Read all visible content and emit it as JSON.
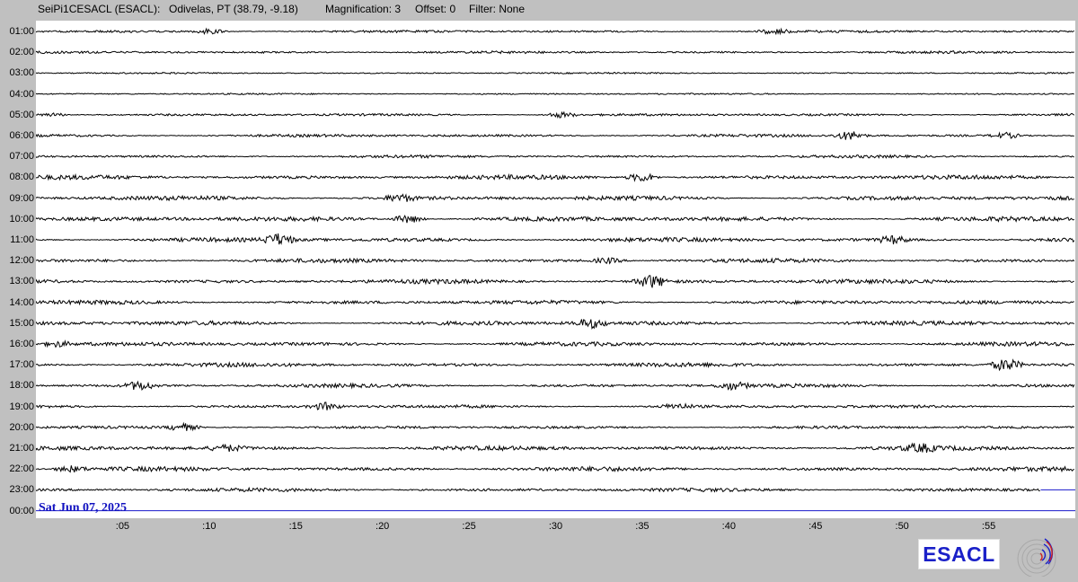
{
  "header": {
    "station": "SeiPi1CESACL (ESACL):",
    "location": "Odivelas, PT (38.79, -9.18)",
    "magnification": "Magnification: 3",
    "offset": "Offset: 0",
    "filter": "Filter: None"
  },
  "date": "Sat Jun 07, 2025",
  "logo": {
    "text": "ESACL",
    "color": "#1a20c8",
    "emblem": "seismograph-emblem"
  },
  "colors": {
    "trace": "#000000",
    "current_line": "#1a1acc",
    "background": "#c0c0c0",
    "plot": "#ffffff"
  },
  "chart_data": {
    "type": "line",
    "title": "",
    "rows": [
      "01:00",
      "02:00",
      "03:00",
      "04:00",
      "05:00",
      "06:00",
      "07:00",
      "08:00",
      "09:00",
      "10:00",
      "11:00",
      "12:00",
      "13:00",
      "14:00",
      "15:00",
      "16:00",
      "17:00",
      "18:00",
      "19:00",
      "20:00",
      "21:00",
      "22:00",
      "23:00",
      "00:00"
    ],
    "x_tick_labels": [
      ":05",
      ":10",
      ":15",
      ":20",
      ":25",
      ":30",
      ":35",
      ":40",
      ":45",
      ":50",
      ":55"
    ],
    "x_tick_minutes": [
      5,
      10,
      15,
      20,
      25,
      30,
      35,
      40,
      45,
      50,
      55
    ],
    "xlim": [
      0,
      60
    ],
    "units": "minutes past the hour",
    "noise_level": [
      1,
      1,
      0.5,
      0.5,
      1,
      1.2,
      1.2,
      2,
      2,
      2.2,
      2,
      1.8,
      2,
      1.8,
      2,
      1.8,
      1.8,
      1.6,
      1.4,
      1.2,
      2,
      2,
      1.6,
      0
    ],
    "events": [
      {
        "row": "01:00",
        "minute": 10.0,
        "amp": 3
      },
      {
        "row": "01:00",
        "minute": 42.6,
        "amp": 3
      },
      {
        "row": "05:00",
        "minute": 1.0,
        "amp": 2
      },
      {
        "row": "05:00",
        "minute": 30.3,
        "amp": 3
      },
      {
        "row": "06:00",
        "minute": 47.0,
        "amp": 5
      },
      {
        "row": "06:00",
        "minute": 56.0,
        "amp": 3
      },
      {
        "row": "08:00",
        "minute": 35.0,
        "amp": 5
      },
      {
        "row": "09:00",
        "minute": 21.0,
        "amp": 4
      },
      {
        "row": "10:00",
        "minute": 21.5,
        "amp": 5
      },
      {
        "row": "11:00",
        "minute": 14.0,
        "amp": 6
      },
      {
        "row": "11:00",
        "minute": 49.5,
        "amp": 4
      },
      {
        "row": "12:00",
        "minute": 33.0,
        "amp": 3
      },
      {
        "row": "13:00",
        "minute": 35.5,
        "amp": 7
      },
      {
        "row": "15:00",
        "minute": 32.0,
        "amp": 5
      },
      {
        "row": "16:00",
        "minute": 1.2,
        "amp": 3
      },
      {
        "row": "17:00",
        "minute": 56.0,
        "amp": 7
      },
      {
        "row": "18:00",
        "minute": 6.0,
        "amp": 5
      },
      {
        "row": "18:00",
        "minute": 40.2,
        "amp": 4
      },
      {
        "row": "19:00",
        "minute": 16.7,
        "amp": 4
      },
      {
        "row": "19:00",
        "minute": 37.0,
        "amp": 3
      },
      {
        "row": "20:00",
        "minute": 8.5,
        "amp": 4
      },
      {
        "row": "21:00",
        "minute": 11.0,
        "amp": 3
      },
      {
        "row": "21:00",
        "minute": 51.0,
        "amp": 4
      },
      {
        "row": "22:00",
        "minute": 2.0,
        "amp": 3
      }
    ],
    "last_row_end_minute": 58,
    "grid": false
  }
}
